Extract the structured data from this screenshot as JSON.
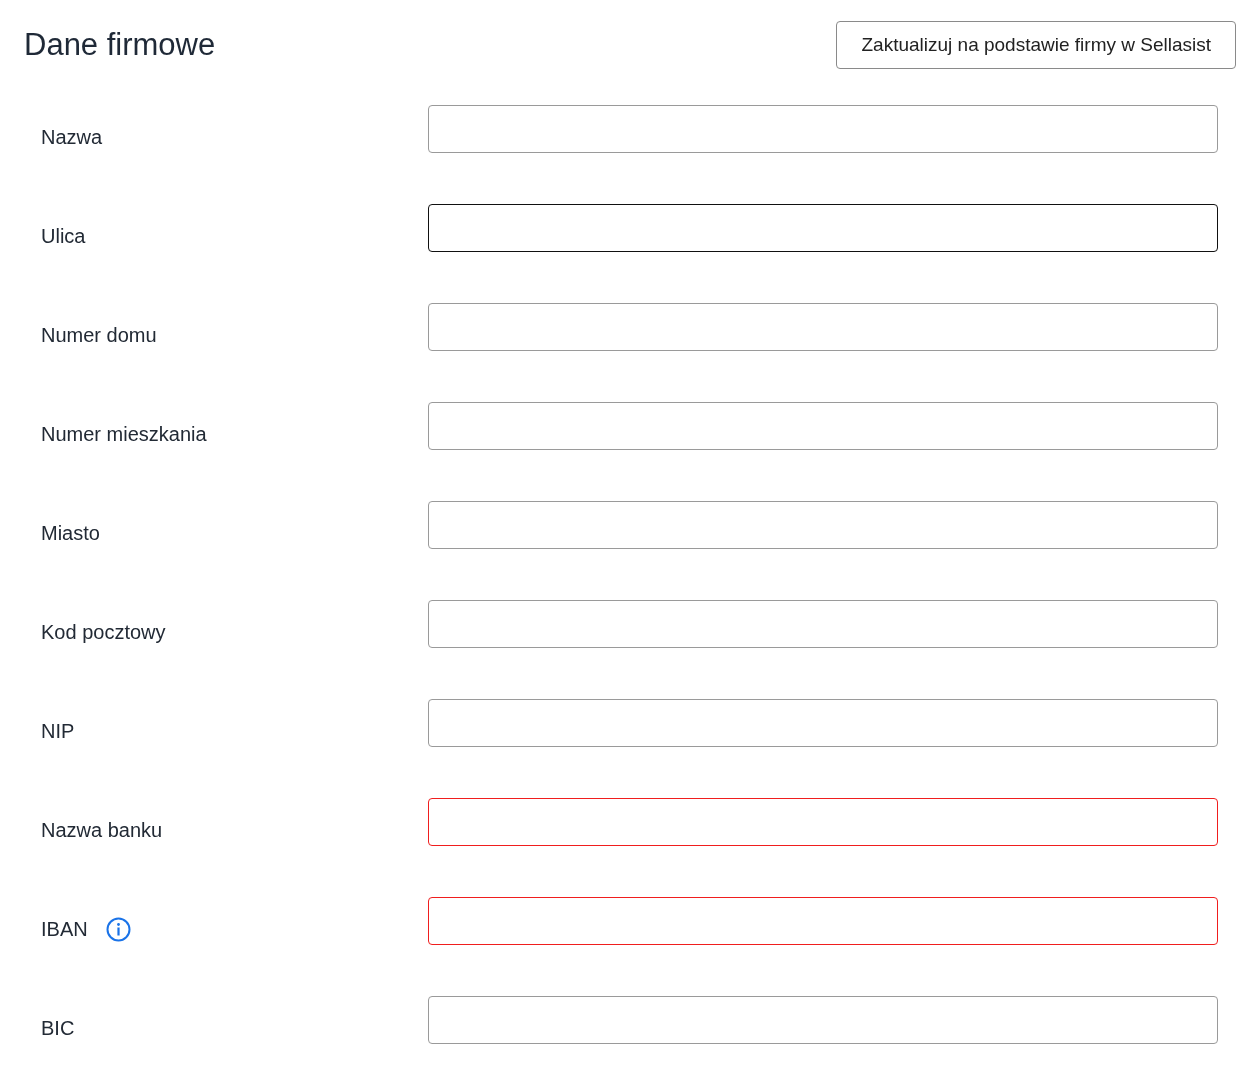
{
  "title": "Dane firmowe",
  "update_button": "Zaktualizuj na podstawie firmy w Sellasist",
  "fields": [
    {
      "label": "Nazwa",
      "focused": false,
      "invalid": false,
      "info": false
    },
    {
      "label": "Ulica",
      "focused": true,
      "invalid": false,
      "info": false
    },
    {
      "label": "Numer domu",
      "focused": false,
      "invalid": false,
      "info": false
    },
    {
      "label": "Numer mieszkania",
      "focused": false,
      "invalid": false,
      "info": false
    },
    {
      "label": "Miasto",
      "focused": false,
      "invalid": false,
      "info": false
    },
    {
      "label": "Kod pocztowy",
      "focused": false,
      "invalid": false,
      "info": false
    },
    {
      "label": "NIP",
      "focused": false,
      "invalid": false,
      "info": false
    },
    {
      "label": "Nazwa banku",
      "focused": false,
      "invalid": true,
      "info": false
    },
    {
      "label": "IBAN",
      "focused": false,
      "invalid": true,
      "info": true
    },
    {
      "label": "BIC",
      "focused": false,
      "invalid": false,
      "info": false
    }
  ]
}
